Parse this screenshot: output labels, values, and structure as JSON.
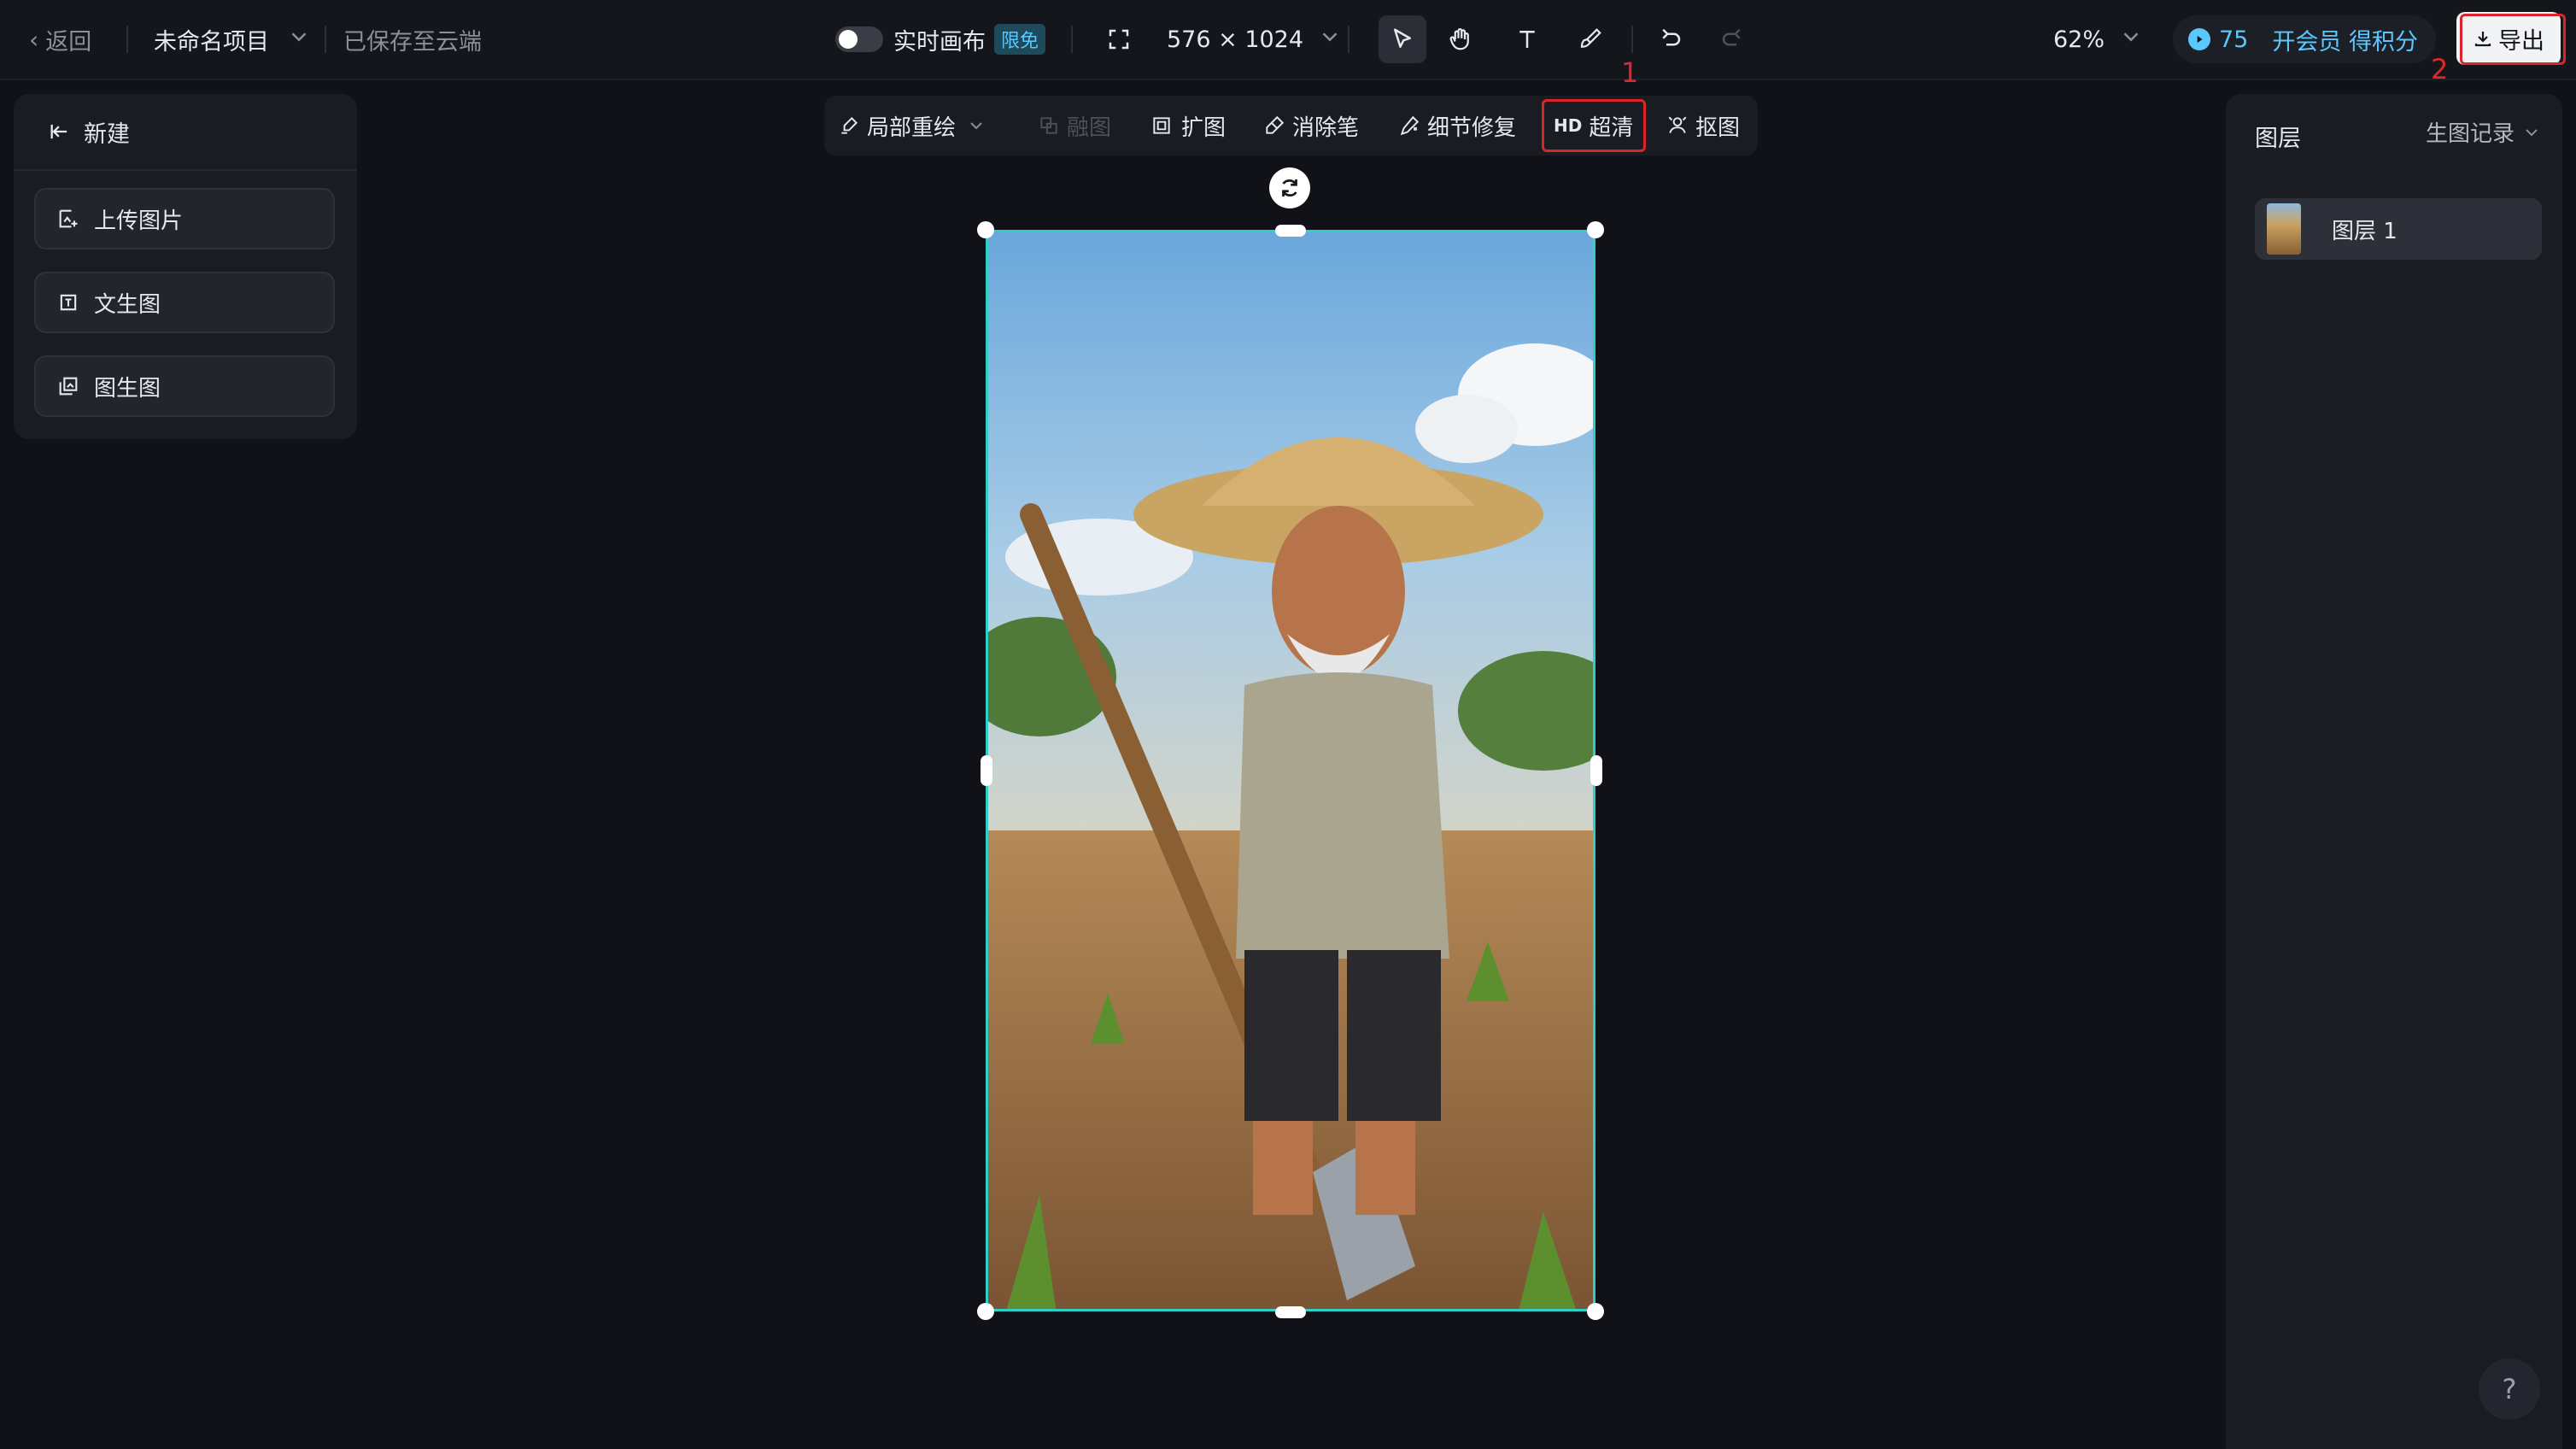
{
  "topbar": {
    "back_label": "返回",
    "project_name": "未命名项目",
    "save_status": "已保存至云端",
    "realtime_label": "实时画布",
    "free_badge": "限免",
    "canvas_size": "576 × 1024",
    "zoom": "62%",
    "credits": "75",
    "member_label": "开会员 得积分",
    "export_label": "导出"
  },
  "left_panel": {
    "new_label": "新建",
    "buttons": [
      {
        "label": "上传图片",
        "icon": "upload-image-icon"
      },
      {
        "label": "文生图",
        "icon": "text-to-image-icon"
      },
      {
        "label": "图生图",
        "icon": "image-to-image-icon"
      }
    ]
  },
  "toolbar": {
    "items": [
      {
        "label": "局部重绘",
        "icon": "brush-repaint-icon"
      },
      {
        "label": "融图",
        "icon": "merge-icon",
        "disabled": true
      },
      {
        "label": "扩图",
        "icon": "expand-icon"
      },
      {
        "label": "消除笔",
        "icon": "eraser-icon"
      },
      {
        "label": "细节修复",
        "icon": "detail-fix-icon"
      },
      {
        "label": "超清",
        "prefix": "HD"
      },
      {
        "label": "抠图",
        "icon": "cutout-icon"
      }
    ]
  },
  "right_panel": {
    "title": "图层",
    "history_label": "生图记录",
    "layers": [
      {
        "name": "图层 1"
      }
    ]
  },
  "annotations": [
    "1",
    "2"
  ],
  "help_label": "?",
  "colors": {
    "accent_teal": "#2fcfc8",
    "annotation_red": "#d9262b",
    "member_blue": "#5bc7ff",
    "bg": "#101218"
  }
}
